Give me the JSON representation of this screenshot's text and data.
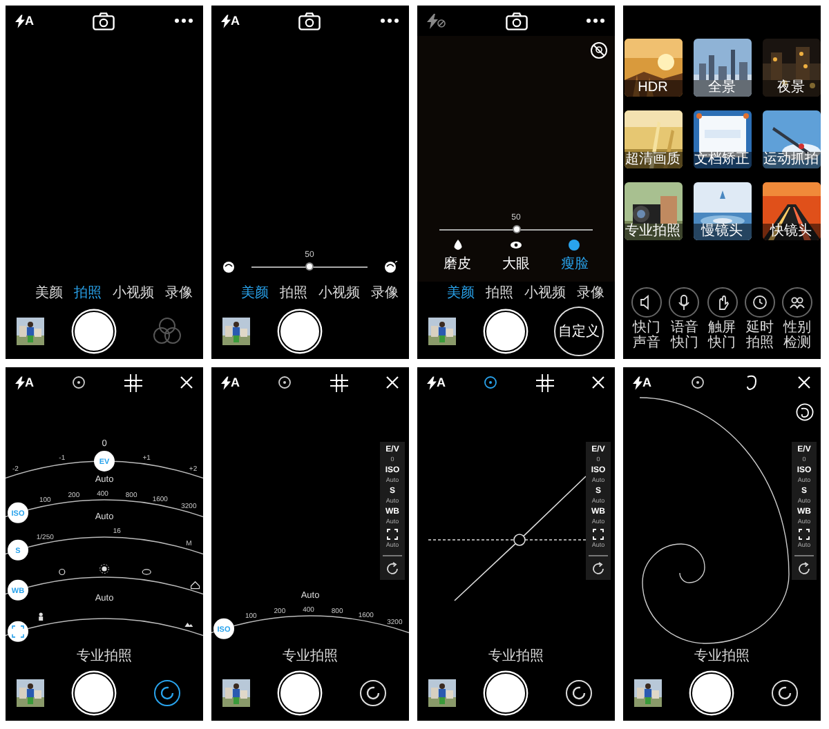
{
  "screens": [
    {
      "top_bar": {
        "kind": "camera",
        "flash": {
          "kind": "auto",
          "label": "A"
        }
      },
      "mode_tabs": [
        {
          "label": "美颜",
          "selected": false
        },
        {
          "label": "拍照",
          "selected": true
        },
        {
          "label": "小视频",
          "selected": false
        },
        {
          "label": "录像",
          "selected": false
        }
      ],
      "right_control": {
        "kind": "filters"
      }
    },
    {
      "kind": "beauty",
      "top_bar": {
        "kind": "camera",
        "flash": {
          "kind": "auto",
          "label": "A"
        }
      },
      "slider": {
        "reading": "50",
        "level": 0.5,
        "end_icons": true
      },
      "mode_tabs": [
        {
          "label": "美颜",
          "selected": true
        },
        {
          "label": "拍照",
          "selected": false
        },
        {
          "label": "小视频",
          "selected": false
        },
        {
          "label": "录像",
          "selected": false
        }
      ]
    },
    {
      "kind": "beauty_custom",
      "top_bar": {
        "kind": "camera",
        "flash": {
          "kind": "off"
        }
      },
      "slider": {
        "reading": "50",
        "level": 0.5,
        "end_icons": false
      },
      "effects": [
        {
          "label": "磨皮",
          "selected": false
        },
        {
          "label": "大眼",
          "selected": false
        },
        {
          "label": "瘦脸",
          "selected": true
        }
      ],
      "mode_tabs": [
        {
          "label": "美颜",
          "selected": true
        },
        {
          "label": "拍照",
          "selected": false
        },
        {
          "label": "小视频",
          "selected": false
        },
        {
          "label": "录像",
          "selected": false
        }
      ],
      "right_control": {
        "kind": "custom",
        "label": "自定义"
      }
    },
    {
      "kind": "modes",
      "modes": [
        {
          "label": "HDR"
        },
        {
          "label": "全景"
        },
        {
          "label": "夜景"
        },
        {
          "label": "超清画质"
        },
        {
          "label": "文档矫正"
        },
        {
          "label": "运动抓拍"
        },
        {
          "label": "专业拍照"
        },
        {
          "label": "慢镜头"
        },
        {
          "label": "快镜头"
        }
      ],
      "toggles": [
        {
          "label": "快门声音"
        },
        {
          "label": "语音快门"
        },
        {
          "label": "触屏快门"
        },
        {
          "label": "延时拍照"
        },
        {
          "label": "性别检测"
        }
      ]
    },
    {
      "kind": "pro",
      "top_bar": {
        "kind": "pro",
        "flash": {
          "kind": "auto",
          "label": "A"
        },
        "meter_selected": false,
        "guide": {
          "kind": "grid"
        }
      },
      "dials": [
        {
          "kind": "ev",
          "button": "EV",
          "value": "0",
          "ticks": [
            "-2",
            "-1",
            "+1",
            "+2"
          ]
        },
        {
          "kind": "scale",
          "button": "ISO",
          "value": "Auto",
          "ticks": [
            "100",
            "200",
            "400",
            "800",
            "1600",
            "3200"
          ]
        },
        {
          "kind": "scale",
          "button": "S",
          "value": "Auto",
          "ticks": [
            "1/250",
            "16",
            "M"
          ]
        },
        {
          "kind": "wb",
          "button": "WB"
        },
        {
          "kind": "focus",
          "value": "Auto"
        }
      ],
      "caption": "专业拍照",
      "right_control": {
        "kind": "reset",
        "active": true
      }
    },
    {
      "kind": "pro",
      "top_bar": {
        "kind": "pro",
        "flash": {
          "kind": "auto",
          "label": "A"
        },
        "meter_selected": false,
        "guide": {
          "kind": "grid"
        }
      },
      "side_panel": [
        {
          "kind": "text",
          "label": "E/V",
          "value": "0"
        },
        {
          "kind": "text",
          "label": "ISO",
          "value": "Auto"
        },
        {
          "kind": "text",
          "label": "S",
          "value": "Auto"
        },
        {
          "kind": "text",
          "label": "WB",
          "value": "Auto"
        },
        {
          "kind": "focus",
          "value": "Auto"
        }
      ],
      "dials": [
        {
          "kind": "scale",
          "button": "ISO",
          "value": "Auto",
          "ticks": [
            "100",
            "200",
            "400",
            "800",
            "1600",
            "3200"
          ]
        }
      ],
      "caption": "专业拍照",
      "right_control": {
        "kind": "reset",
        "active": false
      }
    },
    {
      "kind": "pro",
      "top_bar": {
        "kind": "pro",
        "flash": {
          "kind": "auto",
          "label": "A"
        },
        "meter_selected": true,
        "guide": {
          "kind": "grid"
        }
      },
      "overlay": {
        "kind": "level"
      },
      "side_panel": [
        {
          "kind": "text",
          "label": "E/V",
          "value": "0"
        },
        {
          "kind": "text",
          "label": "ISO",
          "value": "Auto"
        },
        {
          "kind": "text",
          "label": "S",
          "value": "Auto"
        },
        {
          "kind": "text",
          "label": "WB",
          "value": "Auto"
        },
        {
          "kind": "focus",
          "value": "Auto"
        }
      ],
      "caption": "专业拍照",
      "right_control": {
        "kind": "reset",
        "active": false
      }
    },
    {
      "kind": "pro",
      "top_bar": {
        "kind": "pro",
        "flash": {
          "kind": "auto",
          "label": "A"
        },
        "meter_selected": false,
        "guide": {
          "kind": "spiral"
        }
      },
      "overlay": {
        "kind": "spiral"
      },
      "side_panel": [
        {
          "kind": "text",
          "label": "E/V",
          "value": "0"
        },
        {
          "kind": "text",
          "label": "ISO",
          "value": "Auto"
        },
        {
          "kind": "text",
          "label": "S",
          "value": "Auto"
        },
        {
          "kind": "text",
          "label": "WB",
          "value": "Auto"
        },
        {
          "kind": "focus",
          "value": "Auto"
        }
      ],
      "caption": "专业拍照",
      "right_control": {
        "kind": "reset",
        "active": false
      }
    }
  ]
}
